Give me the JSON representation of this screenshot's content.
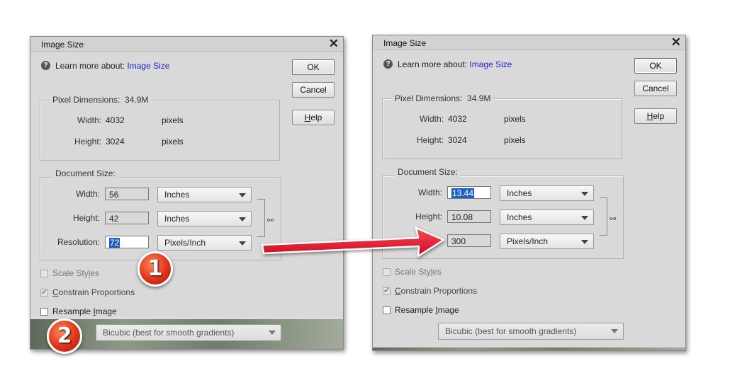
{
  "dialog_left": {
    "title": "Image Size",
    "learn_prefix": "Learn more about:",
    "learn_link": "Image Size",
    "buttons": {
      "ok": "OK",
      "cancel": "Cancel",
      "help_h": "H",
      "help_rest": "elp"
    },
    "pixel_dimensions": {
      "label": "Pixel Dimensions:",
      "size": "34.9M",
      "width_label": "Width:",
      "width_value": "4032",
      "width_unit": "pixels",
      "height_label": "Height:",
      "height_value": "3024",
      "height_unit": "pixels"
    },
    "document_size": {
      "label": "Document Size:",
      "width_label": "Width:",
      "width_value": "56",
      "width_unit": "Inches",
      "height_label": "Height:",
      "height_value": "42",
      "height_unit": "Inches",
      "resolution_label": "Resolution:",
      "resolution_value": "72",
      "resolution_unit": "Pixels/Inch"
    },
    "scale_styles": {
      "pre": "Scale Sty",
      "ul": "l",
      "post": "es",
      "checked": false,
      "enabled": false
    },
    "constrain": {
      "pre": "",
      "ul": "C",
      "post": "onstrain Proportions",
      "checked": true,
      "enabled": false
    },
    "resample": {
      "pre": "Resample ",
      "ul": "I",
      "post": "mage",
      "checked": false,
      "enabled": true
    },
    "method": "Bicubic (best for smooth gradients)"
  },
  "dialog_right": {
    "title": "Image Size",
    "learn_prefix": "Learn more about:",
    "learn_link": "Image Size",
    "buttons": {
      "ok": "OK",
      "cancel": "Cancel",
      "help_h": "H",
      "help_rest": "elp"
    },
    "pixel_dimensions": {
      "label": "Pixel Dimensions:",
      "size": "34.9M",
      "width_label": "Width:",
      "width_value": "4032",
      "width_unit": "pixels",
      "height_label": "Height:",
      "height_value": "3024",
      "height_unit": "pixels"
    },
    "document_size": {
      "label": "Document Size:",
      "width_label": "Width:",
      "width_value": "13.44",
      "width_unit": "Inches",
      "height_label": "Height:",
      "height_value": "10.08",
      "height_unit": "Inches",
      "resolution_label_visible": "Res",
      "resolution_value": "300",
      "resolution_unit": "Pixels/Inch"
    },
    "scale_styles": {
      "pre": "Scale Sty",
      "ul": "l",
      "post": "es",
      "checked": false,
      "enabled": false
    },
    "constrain": {
      "pre": "",
      "ul": "C",
      "post": "onstrain Proportions",
      "checked": true,
      "enabled": false
    },
    "resample": {
      "pre": "Resample ",
      "ul": "I",
      "post": "mage",
      "checked": false,
      "enabled": true
    },
    "method": "Bicubic (best for smooth gradients)"
  },
  "annotations": {
    "step1": "1",
    "step2": "2",
    "arrow_color": "#e8142a"
  },
  "icons": {
    "help": "question-circle-icon",
    "close": "close-x-icon",
    "link": "chain-link-icon"
  }
}
